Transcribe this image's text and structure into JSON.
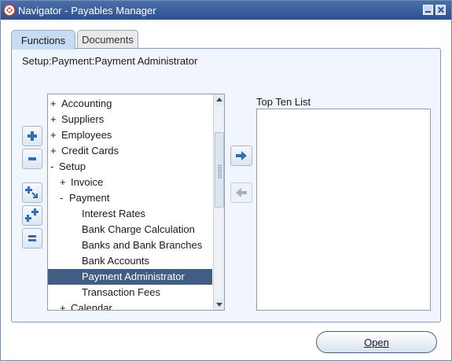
{
  "window": {
    "title": "Navigator - Payables Manager",
    "accent_color": "#2d5190"
  },
  "tabs": [
    {
      "label": "Functions",
      "active": true
    },
    {
      "label": "Documents",
      "active": false
    }
  ],
  "breadcrumb": "Setup:Payment:Payment Administrator",
  "tree": {
    "items": [
      {
        "marker": "+",
        "label": "Accounting"
      },
      {
        "marker": "+",
        "label": "Suppliers"
      },
      {
        "marker": "+",
        "label": "Employees"
      },
      {
        "marker": "+",
        "label": "Credit Cards"
      },
      {
        "marker": "-",
        "label": "Setup"
      },
      {
        "marker": "+",
        "label": "Invoice"
      },
      {
        "marker": "-",
        "label": "Payment"
      },
      {
        "marker": "",
        "label": "Interest Rates"
      },
      {
        "marker": "",
        "label": "Bank Charge Calculation"
      },
      {
        "marker": "",
        "label": "Banks and Bank Branches"
      },
      {
        "marker": "",
        "label": "Bank Accounts"
      },
      {
        "marker": "",
        "label": "Payment Administrator"
      },
      {
        "marker": "",
        "label": "Transaction Fees"
      },
      {
        "marker": "+",
        "label": "Calendar"
      }
    ],
    "selected_label": "Payment Administrator"
  },
  "side_buttons": {
    "expand_icon": "plus-icon",
    "collapse_icon": "minus-icon",
    "expand_branch_icon": "expand-branch-icon",
    "expand_all_icon": "expand-all-icon",
    "collapse_all_icon": "collapse-all-icon"
  },
  "move_buttons": {
    "add_icon": "arrow-right-icon",
    "remove_icon": "arrow-left-icon"
  },
  "top_ten": {
    "label": "Top Ten List",
    "items": []
  },
  "open_button": {
    "label": "Open"
  },
  "colors": {
    "panel_bg": "#f0f6fc",
    "selection": "#415d84",
    "active_tab": "#c7dcf2"
  }
}
